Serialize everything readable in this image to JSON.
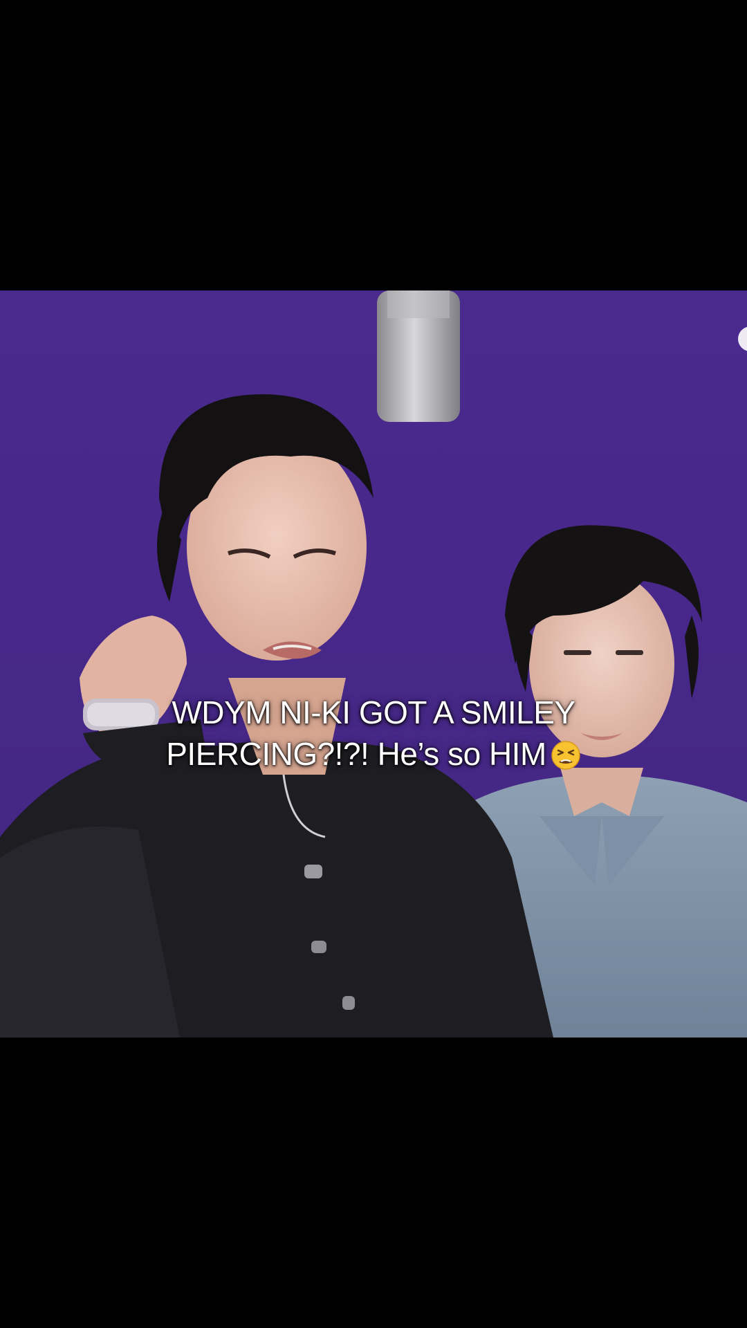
{
  "video": {
    "caption_line1": "WDYM NI-KI GOT A SMILEY",
    "caption_line2": "PIERCING?!?! He’s so HIM",
    "caption_emoji": "tired-face-emoji",
    "background_color": "#47288a"
  }
}
